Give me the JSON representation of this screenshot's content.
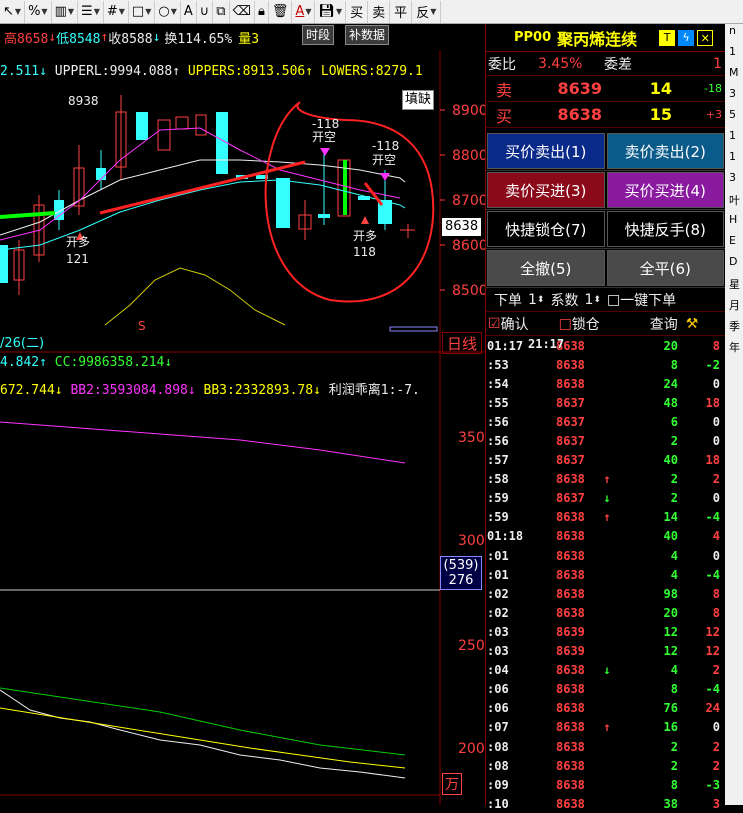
{
  "toolbar": {
    "tools": [
      "pointer-tool",
      "percent-tool",
      "layout-tool",
      "list-tool",
      "grid-tool",
      "rect-tool",
      "circle-tool",
      "text-tool",
      "magnet-tool",
      "copy-tool",
      "clear-tool",
      "lock-tool",
      "delete-tool",
      "color-tool",
      "save-tool"
    ],
    "buttons": [
      "买",
      "卖",
      "平",
      "反"
    ]
  },
  "infobar": {
    "high": "高8658",
    "low": "低8548",
    "close": "收8588",
    "turnover": "换114.65%",
    "vol": "量3"
  },
  "period_btn": "时段",
  "patch_btn": "补数据",
  "indicators": {
    "line1": {
      "v0": "2.511",
      "upper": "UPPERL:9994.088",
      "uppers": "UPPERS:8913.506",
      "lowers": "LOWERS:8279.1"
    },
    "line2": {
      "v": "4.842",
      "cc": "CC:9986358.214"
    },
    "line3": {
      "bb1": "672.744",
      "bb2": "BB2:3593084.898",
      "bb3": "BB3:2332893.78",
      "lr": "利润乖离1:-7."
    },
    "bottom": "511  UPPERL:9994.088  UPPERS:8913.506  LOWERS:8279.1"
  },
  "annotations": {
    "tag": "填缺",
    "date": "/26(二)",
    "daily": "日线",
    "wan": "万"
  },
  "price_axis": [
    "8900",
    "8800",
    "8700",
    "8600",
    "8500"
  ],
  "vol_axis": [
    "350",
    "300",
    "250",
    "200"
  ],
  "current_price": "8638",
  "vol_tag": {
    "top": "(539)",
    "bottom": "276"
  },
  "chart_texts": {
    "max": "8938",
    "open_long": "开多",
    "open_long2": "开多",
    "close_long": "开空",
    "close_long2": "开空",
    "n121": "121",
    "n118": "118",
    "t118a": "-118",
    "t118b": "-118"
  },
  "panel": {
    "ticker": "PP00",
    "name": "聚丙烯连续",
    "weibi_label": "委比",
    "weibi": "3.45%",
    "weicha_label": "委差",
    "weicha": "1",
    "sell_label": "卖",
    "sell_price": "8639",
    "sell_vol": "14",
    "sell_chg": "-18",
    "buy_label": "买",
    "buy_price": "8638",
    "buy_vol": "15",
    "buy_chg": "+3",
    "btns": [
      [
        "买价卖出(1)",
        "卖价卖出(2)"
      ],
      [
        "卖价买进(3)",
        "买价买进(4)"
      ],
      [
        "快捷锁仓(7)",
        "快捷反手(8)"
      ],
      [
        "全撤(5)",
        "全平(6)"
      ]
    ],
    "order_label": "下单",
    "order_qty": "1",
    "coef_label": "系数",
    "coef_qty": "1",
    "one_key": "一键下单",
    "confirm": "确认",
    "lock": "锁仓",
    "query": "查询",
    "ticks": [
      [
        "01:17",
        "8638",
        "",
        "20",
        "8"
      ],
      [
        ":53",
        "8638",
        "",
        "8",
        "-2"
      ],
      [
        ":54",
        "8638",
        "",
        "24",
        "0"
      ],
      [
        ":55",
        "8637",
        "",
        "48",
        "18"
      ],
      [
        ":56",
        "8637",
        "",
        "6",
        "0"
      ],
      [
        ":56",
        "8637",
        "",
        "2",
        "0"
      ],
      [
        ":57",
        "8637",
        "",
        "40",
        "18"
      ],
      [
        ":58",
        "8638",
        "↑",
        "2",
        "2"
      ],
      [
        ":59",
        "8637",
        "↓",
        "2",
        "0"
      ],
      [
        ":59",
        "8638",
        "↑",
        "14",
        "-4"
      ],
      [
        "01:18",
        "8638",
        "",
        "40",
        "4"
      ],
      [
        ":01",
        "8638",
        "",
        "4",
        "0"
      ],
      [
        ":01",
        "8638",
        "",
        "4",
        "-4"
      ],
      [
        ":02",
        "8638",
        "",
        "98",
        "8"
      ],
      [
        ":02",
        "8638",
        "",
        "20",
        "8"
      ],
      [
        ":03",
        "8639",
        "",
        "12",
        "12"
      ],
      [
        ":03",
        "8639",
        "",
        "12",
        "12"
      ],
      [
        ":04",
        "8638",
        "↓",
        "4",
        "2"
      ],
      [
        ":06",
        "8638",
        "",
        "8",
        "-4"
      ],
      [
        ":06",
        "8638",
        "",
        "76",
        "24"
      ],
      [
        ":07",
        "8638",
        "↑",
        "16",
        "0"
      ],
      [
        ":08",
        "8638",
        "",
        "2",
        "2"
      ],
      [
        ":08",
        "8638",
        "",
        "2",
        "2"
      ],
      [
        ":09",
        "8638",
        "",
        "8",
        "-3"
      ],
      [
        ":10",
        "8638",
        "",
        "38",
        "3"
      ]
    ],
    "tick_time2": "21:17"
  },
  "edge": [
    "n",
    "1",
    "M",
    "3",
    "5",
    "1",
    "1",
    "3",
    "叶",
    "H",
    "E",
    "D",
    "星",
    "月",
    "季",
    "年"
  ]
}
